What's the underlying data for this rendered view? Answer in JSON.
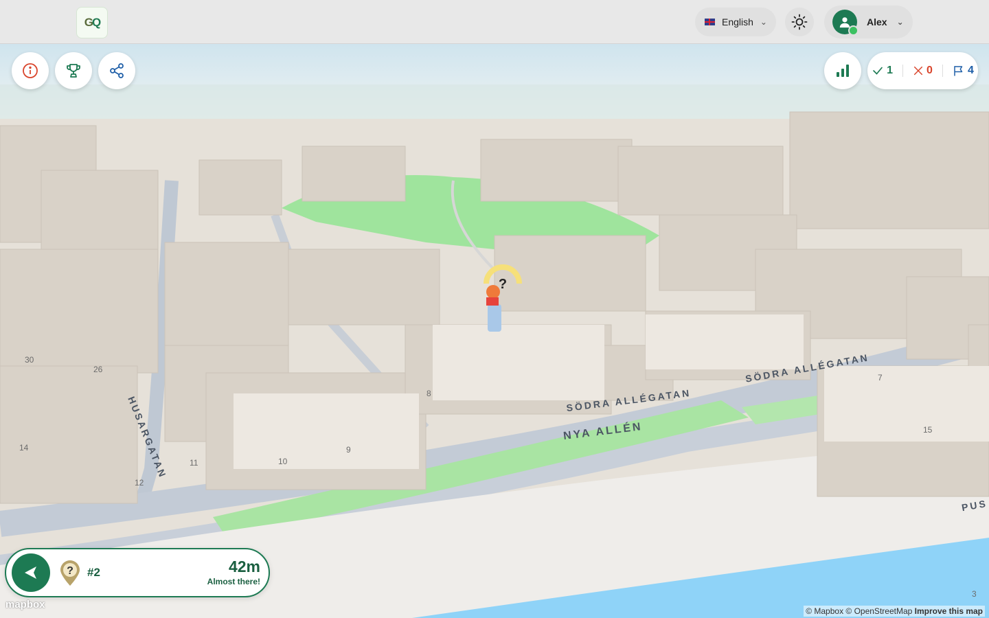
{
  "header": {
    "logo_text_g": "G",
    "logo_text_q": "Q",
    "language": "English",
    "user_name": "Alex"
  },
  "score": {
    "correct": "1",
    "wrong": "0",
    "flags": "4"
  },
  "map": {
    "streets": [
      "SÖDRA ALLÉGATAN",
      "SÖDRA ALLÉGATAN",
      "NYA ALLÉN",
      "HUSARGATAN",
      "PUS"
    ],
    "house_numbers": [
      "30",
      "26",
      "14",
      "12",
      "11",
      "10",
      "9",
      "8",
      "7",
      "15",
      "3"
    ]
  },
  "panel": {
    "question_number": "#2",
    "distance": "42m",
    "hint": "Almost there!"
  },
  "attribution": {
    "mapbox_logo": "mapbox",
    "text": "© Mapbox © OpenStreetMap",
    "improve": "Improve this map"
  },
  "colors": {
    "brand": "#1d7a53",
    "correct": "#1d7a53",
    "wrong": "#d9442b",
    "flag": "#1f5fa8"
  }
}
